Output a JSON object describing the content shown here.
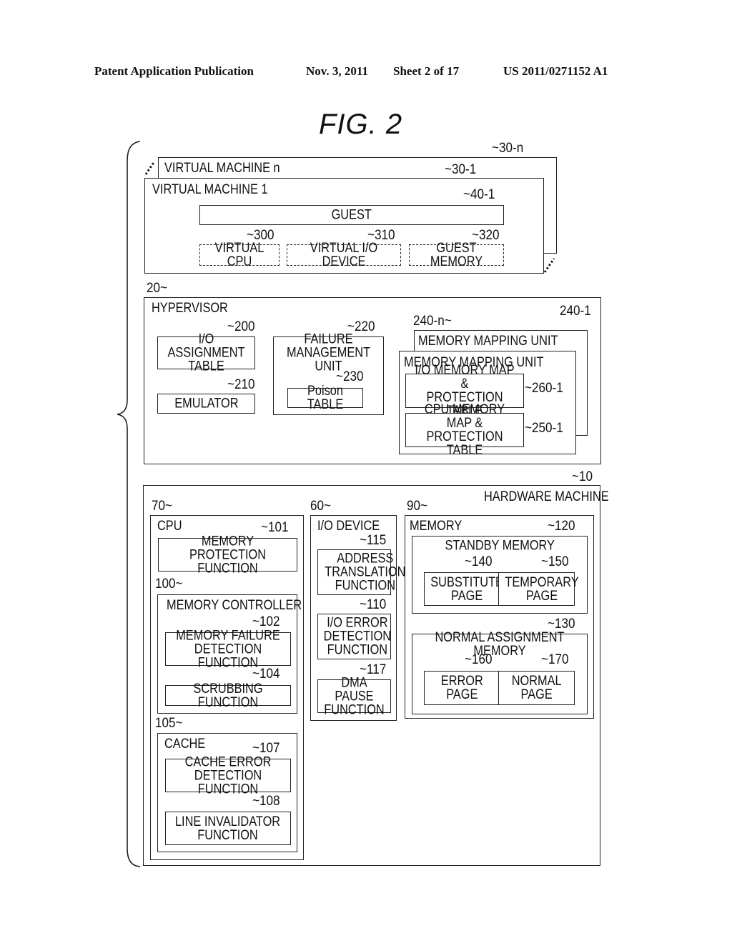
{
  "header": {
    "publication": "Patent Application Publication",
    "date": "Nov. 3, 2011",
    "sheet": "Sheet 2 of 17",
    "number": "US 2011/0271152 A1"
  },
  "figure_title": "FIG.  2",
  "virtual_machines": {
    "vm_n": {
      "label": "VIRTUAL MACHINE n",
      "ref": "30-n"
    },
    "vm_1": {
      "label": "VIRTUAL MACHINE 1",
      "ref": "30-1",
      "guest": {
        "label": "GUEST",
        "ref": "40-1"
      },
      "virtual_cpu": {
        "label": "VIRTUAL CPU",
        "ref": "300"
      },
      "virtual_io": {
        "label": "VIRTUAL I/O DEVICE",
        "ref": "310"
      },
      "guest_memory": {
        "label": "GUEST MEMORY",
        "ref": "320"
      }
    }
  },
  "hypervisor": {
    "label": "HYPERVISOR",
    "ref": "20",
    "io_assignment_table": {
      "label": "I/O ASSIGNMENT\nTABLE",
      "ref": "200"
    },
    "emulator": {
      "label": "EMULATOR",
      "ref": "210"
    },
    "failure_management_unit": {
      "label": "FAILURE\nMANAGEMENT UNIT",
      "ref": "220"
    },
    "poison_table": {
      "label": "Poison TABLE",
      "ref": "230"
    },
    "mmu_n": {
      "label": "MEMORY MAPPING UNIT",
      "ref": "240-n"
    },
    "mmu_1": {
      "label": "MEMORY MAPPING UNIT",
      "ref": "240-1",
      "io_map": {
        "label": "I/O MEMORY MAP &\nPROTECTION TABLE",
        "ref": "260-1"
      },
      "cpu_map": {
        "label": "CPU MEMORY MAP &\nPROTECTION TABLE",
        "ref": "250-1"
      }
    }
  },
  "hardware": {
    "label": "HARDWARE MACHINE",
    "ref": "10",
    "cpu": {
      "label": "CPU",
      "ref": "70",
      "memory_protection": {
        "label": "MEMORY PROTECTION\nFUNCTION",
        "ref": "101"
      },
      "memory_controller": {
        "label": "MEMORY CONTROLLER",
        "ref": "100",
        "failure_detection": {
          "label": "MEMORY FAILURE\nDETECTION FUNCTION",
          "ref": "102"
        },
        "scrubbing": {
          "label": "SCRUBBING FUNCTION",
          "ref": "104"
        }
      },
      "cache": {
        "label": "CACHE",
        "ref": "105",
        "cache_error": {
          "label": "CACHE ERROR\nDETECTION FUNCTION",
          "ref": "107"
        },
        "line_invalidator": {
          "label": "LINE INVALIDATOR\nFUNCTION",
          "ref": "108"
        }
      }
    },
    "io_device": {
      "label": "I/O DEVICE",
      "ref": "60",
      "address_translation": {
        "label": "ADDRESS\nTRANSLATION\nFUNCTION",
        "ref": "115"
      },
      "io_error": {
        "label": "I/O ERROR\nDETECTION\nFUNCTION",
        "ref": "110"
      },
      "dma_pause": {
        "label": "DMA PAUSE\nFUNCTION",
        "ref": "117"
      }
    },
    "memory": {
      "label": "MEMORY",
      "ref": "90",
      "standby": {
        "label": "STANDBY MEMORY",
        "ref": "120",
        "substitute_page": {
          "label": "SUBSTITUTE\nPAGE",
          "ref": "140"
        },
        "temporary_page": {
          "label": "TEMPORARY\nPAGE",
          "ref": "150"
        }
      },
      "normal_assignment": {
        "label": "NORMAL ASSIGNMENT MEMORY",
        "ref": "130",
        "error_page": {
          "label": "ERROR\nPAGE",
          "ref": "160"
        },
        "normal_page": {
          "label": "NORMAL\nPAGE",
          "ref": "170"
        }
      }
    }
  }
}
